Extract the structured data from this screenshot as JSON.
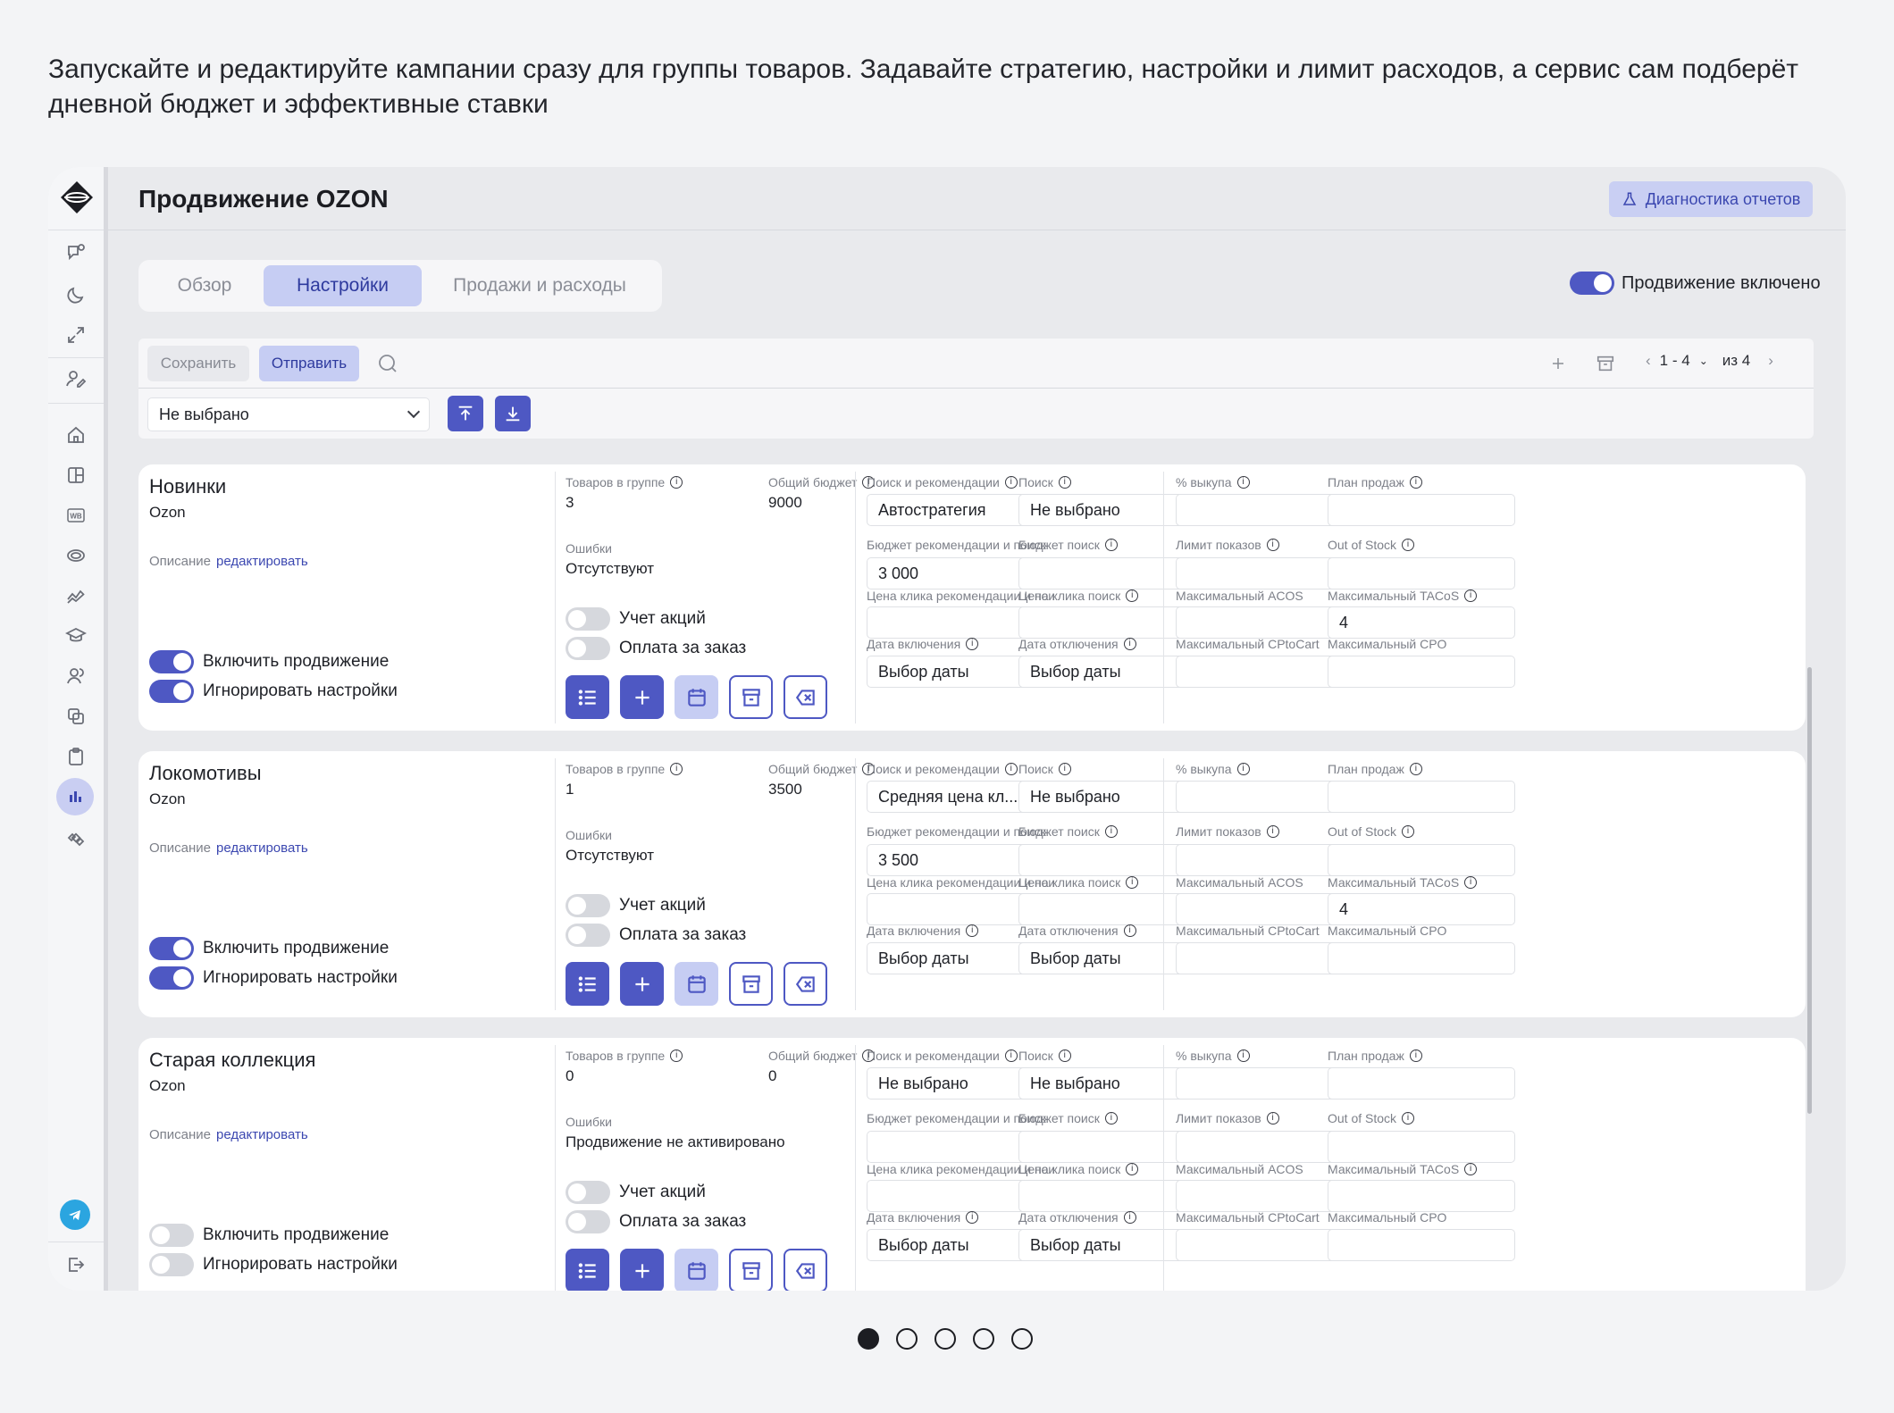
{
  "intro_text": "Запускайте и редактируйте кампании сразу для группы товаров. Задавайте стратегию, настройки и лимит расходов, а сервис сам подберёт дневной бюджет и эффективные ставки",
  "header": {
    "title": "Продвижение OZON",
    "diagnostics_button": "Диагностика отчетов"
  },
  "tabs": [
    "Обзор",
    "Настройки",
    "Продажи и расходы"
  ],
  "active_tab": "Настройки",
  "promo_toggle_label": "Продвижение включено",
  "toolbar": {
    "save": "Сохранить",
    "send": "Отправить",
    "pager_range": "1 - 4",
    "pager_total": "из 4",
    "select_value": "Не выбрано"
  },
  "labels": {
    "items_in_group": "Товаров в группе",
    "total_budget": "Общий бюджет",
    "errors": "Ошибки",
    "description": "Описание",
    "edit": "редактировать",
    "promo_accounting": "Учет акций",
    "pay_per_order": "Оплата за заказ",
    "enable_promo": "Включить продвижение",
    "ignore_settings": "Игнорировать настройки",
    "search_recommend": "Поиск и рекомендации",
    "search": "Поиск",
    "budget_recommend": "Бюджет рекомендации и поиск",
    "budget_search": "Бюджет поиск",
    "click_price_recommend": "Цена клика рекомендации и поиск",
    "click_price_search": "Цена клика поиск",
    "date_on": "Дата включения",
    "date_off": "Дата отключения",
    "buyout": "% выкупа",
    "sales_plan": "План продаж",
    "impressions_limit": "Лимит показов",
    "out_of_stock": "Out of Stock",
    "max_acos": "Максимальный ACOS",
    "max_tacos": "Максимальный TACoS",
    "max_cptocart": "Максимальный CPtoCart",
    "max_cpo": "Максимальный CPO",
    "date_placeholder": "Выбор даты"
  },
  "groups": [
    {
      "name": "Новинки",
      "marketplace": "Ozon",
      "items": "3",
      "budget": "9000",
      "errors": "Отсутствуют",
      "promo_accounting": false,
      "pay_per_order": false,
      "enable_promo": true,
      "ignore_settings": true,
      "strategy": "Автостратегия",
      "search": "Не выбрано",
      "budget_recommend": "3 000",
      "max_tacos": "4"
    },
    {
      "name": "Локомотивы",
      "marketplace": "Ozon",
      "items": "1",
      "budget": "3500",
      "errors": "Отсутствуют",
      "promo_accounting": false,
      "pay_per_order": false,
      "enable_promo": true,
      "ignore_settings": true,
      "strategy": "Средняя цена кл...",
      "search": "Не выбрано",
      "budget_recommend": "3 500",
      "max_tacos": "4"
    },
    {
      "name": "Старая коллекция",
      "marketplace": "Ozon",
      "items": "0",
      "budget": "0",
      "errors": "Продвижение не активировано",
      "promo_accounting": false,
      "pay_per_order": false,
      "enable_promo": false,
      "ignore_settings": false,
      "strategy": "Не выбрано",
      "search": "Не выбрано",
      "budget_recommend": "",
      "max_tacos": ""
    }
  ],
  "sidebar_icons": [
    "chat-icon",
    "moon-icon",
    "expand-icon",
    "user-edit-icon",
    "home-icon",
    "layout-icon",
    "wb-icon",
    "ozon-icon",
    "analytics-icon",
    "education-icon",
    "users-icon",
    "copy-icon",
    "clipboard-icon",
    "chart-icon",
    "satellite-icon",
    "telegram-icon",
    "logout-icon"
  ],
  "colors": {
    "accent": "#4e58c3",
    "accent_light": "#c6cdf3",
    "telegram": "#2ba5e0",
    "help": "#2f7de0"
  },
  "carousel": {
    "count": 5,
    "active": 0
  }
}
